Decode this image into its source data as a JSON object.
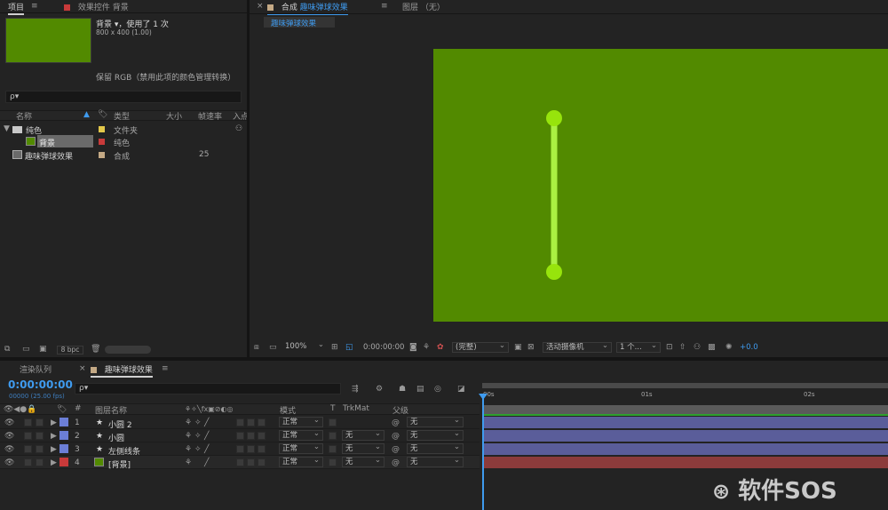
{
  "project_panel": {
    "tab_project": "项目",
    "tab_effects": "效果控件 背景",
    "footage_name": "背景 ▾，使用了 1 次",
    "footage_size": "800 x 400 (1.00)",
    "color_note": "保留 RGB（禁用此项的颜色管理转换）",
    "search_placeholder": "ρ▾",
    "columns": {
      "name": "名称",
      "type": "类型",
      "size": "大小",
      "fps": "帧速率",
      "in": "入点"
    },
    "items": [
      {
        "name": "纯色",
        "type": "文件夹",
        "fps": "",
        "label_color": "#e3c84a"
      },
      {
        "name": "背景",
        "type": "纯色",
        "fps": "",
        "label_color": "#c83a3a"
      },
      {
        "name": "趣味弹球效果",
        "type": "合成",
        "fps": "25",
        "label_color": "#c4a985"
      }
    ],
    "bpc": "8 bpc"
  },
  "comp_viewer": {
    "tab_comp_prefix": "合成",
    "tab_comp_name": "趣味弹球效果",
    "tab_layer": "图层 （无）",
    "sub_tab": "趣味弹球效果",
    "background_color": "#528a00",
    "line_color": "#aaf042",
    "ball_color": "#97e40c",
    "toolbar": {
      "zoom": "100%",
      "timecode": "0:00:00:00",
      "resolution": "(完整)",
      "camera": "活动摄像机",
      "views": "1 个...",
      "exposure": "+0.0"
    }
  },
  "timeline": {
    "tab_render": "渲染队列",
    "tab_comp": "趣味弹球效果",
    "timecode": "0:00:00:00",
    "frame_info": "00000 (25.00 fps)",
    "search_placeholder": "ρ▾",
    "columns": {
      "num": "#",
      "layer_name": "图层名称",
      "mode": "模式",
      "t": "T",
      "trkmat": "TrkMat",
      "parent": "父级"
    },
    "ruler": [
      "00s",
      "01s",
      "02s"
    ],
    "layers": [
      {
        "num": "1",
        "name": "小圆 2",
        "star": "★",
        "mode": "正常",
        "trkmat": "",
        "parent": "无",
        "color": "#6b7ed6"
      },
      {
        "num": "2",
        "name": "小圆",
        "star": "★",
        "mode": "正常",
        "trkmat": "无",
        "parent": "无",
        "color": "#6b7ed6"
      },
      {
        "num": "3",
        "name": "左侧线条",
        "star": "★",
        "mode": "正常",
        "trkmat": "无",
        "parent": "无",
        "color": "#6b7ed6"
      },
      {
        "num": "4",
        "name": "[背景]",
        "star": "",
        "mode": "正常",
        "trkmat": "无",
        "parent": "无",
        "color": "#c83a3a"
      }
    ]
  },
  "watermark": "软件SOS"
}
